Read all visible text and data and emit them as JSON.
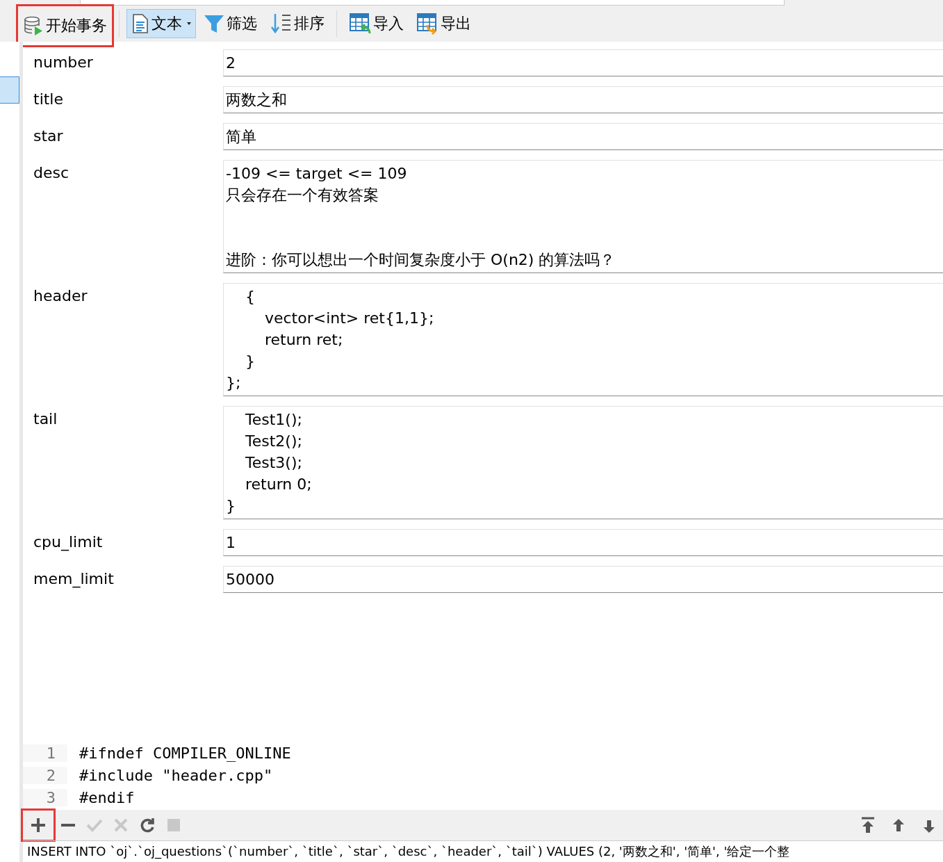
{
  "toolbar": {
    "buttons": [
      {
        "kind": "transaction",
        "label": "开始事务",
        "highlighted": true,
        "selected": false
      },
      {
        "kind": "text",
        "label": "文本",
        "highlighted": false,
        "selected": true
      },
      {
        "kind": "filter",
        "label": "筛选",
        "highlighted": false,
        "selected": false
      },
      {
        "kind": "sort",
        "label": "排序",
        "highlighted": false,
        "selected": false
      },
      {
        "kind": "import",
        "label": "导入",
        "highlighted": false,
        "selected": false
      },
      {
        "kind": "export",
        "label": "导出",
        "highlighted": false,
        "selected": false
      }
    ]
  },
  "form": {
    "fields": [
      {
        "label": "number",
        "value": "2"
      },
      {
        "label": "title",
        "value": "两数之和"
      },
      {
        "label": "star",
        "value": "简单"
      },
      {
        "label": "desc",
        "lines": [
          "-109 <= target <= 109",
          "只会存在一个有效答案"
        ],
        "note": "进阶：你可以想出一个时间复杂度小于 O(n2) 的算法吗？"
      },
      {
        "label": "header",
        "value": "    {\n        vector<int> ret{1,1};\n        return ret;\n    }\n};"
      },
      {
        "label": "tail",
        "value": "    Test1();\n    Test2();\n    Test3();\n    return 0;\n}"
      },
      {
        "label": "cpu_limit",
        "value": "1"
      },
      {
        "label": "mem_limit",
        "value": "50000"
      }
    ]
  },
  "editor": {
    "lines": [
      {
        "number": "1",
        "code": "#ifndef COMPILER_ONLINE"
      },
      {
        "number": "2",
        "code": "#include \"header.cpp\""
      },
      {
        "number": "3",
        "code": "#endif"
      }
    ]
  },
  "bottom_bar": {
    "left": [
      {
        "kind": "add",
        "disabled": false,
        "highlighted": true
      },
      {
        "kind": "remove",
        "disabled": false,
        "highlighted": false
      },
      {
        "kind": "apply",
        "disabled": true,
        "highlighted": false
      },
      {
        "kind": "cancel",
        "disabled": true,
        "highlighted": false
      },
      {
        "kind": "refresh",
        "disabled": false,
        "highlighted": false
      },
      {
        "kind": "stop",
        "disabled": true,
        "highlighted": false
      }
    ],
    "right": [
      {
        "kind": "first"
      },
      {
        "kind": "previous"
      },
      {
        "kind": "next"
      }
    ]
  },
  "status_bar": {
    "sql": "INSERT INTO `oj`.`oj_questions`(`number`, `title`, `star`, `desc`, `header`, `tail`) VALUES (2, '两数之和', '简单', '给定一个整"
  }
}
